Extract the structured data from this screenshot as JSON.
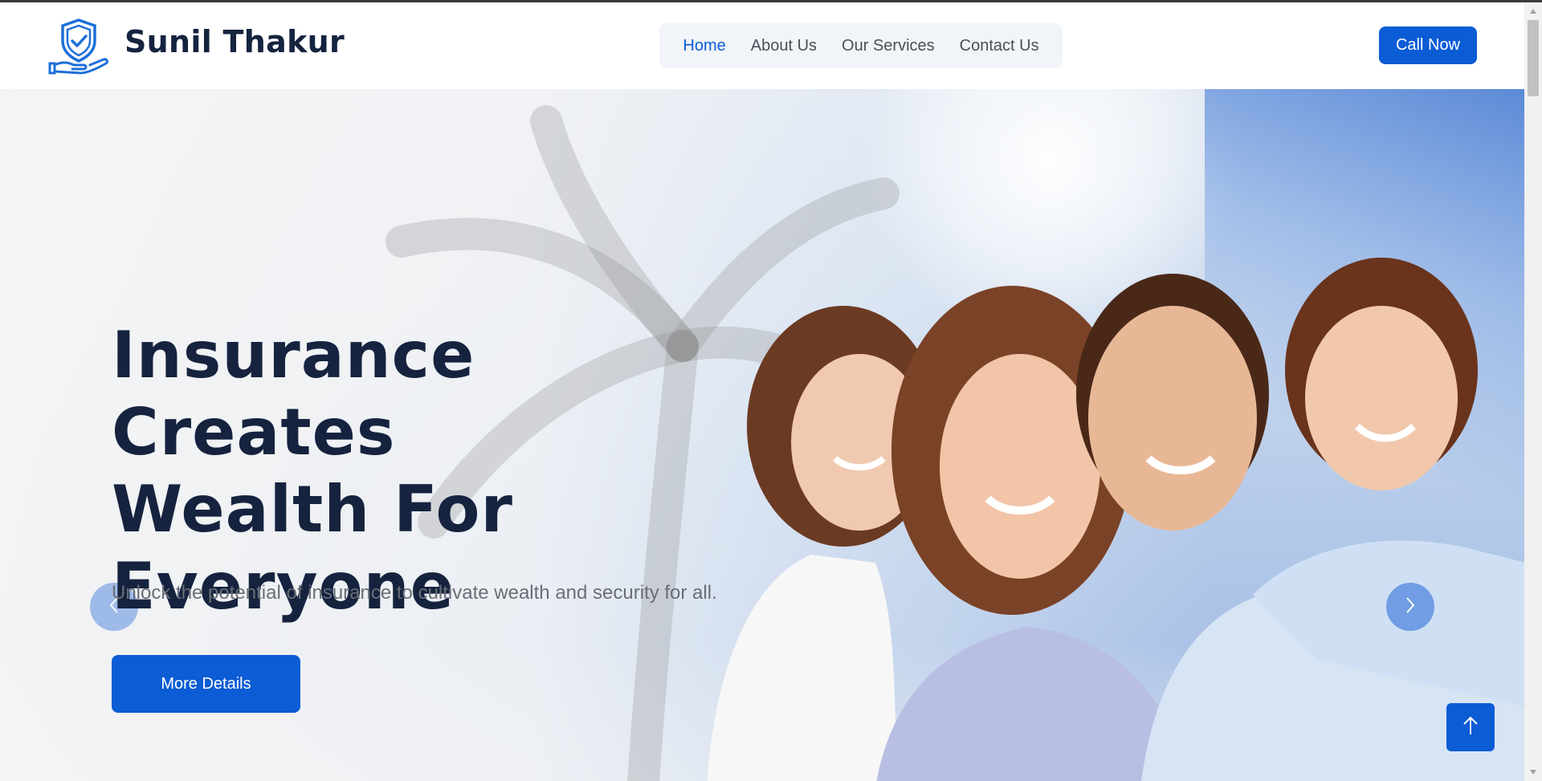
{
  "header": {
    "brand": "Sunil Thakur",
    "logo_icon": "shield-hand-icon",
    "nav": [
      {
        "label": "Home",
        "active": true
      },
      {
        "label": "About Us",
        "active": false
      },
      {
        "label": "Our Services",
        "active": false
      },
      {
        "label": "Contact Us",
        "active": false
      }
    ],
    "call_label": "Call Now"
  },
  "hero": {
    "headline_line1": "Insurance Creates",
    "headline_line2": "Wealth For",
    "headline_line3": "Everyone",
    "subtitle": "Unlock the potential of insurance to cultivate wealth and security for all.",
    "cta_label": "More Details",
    "prev_icon": "chevron-left-icon",
    "next_icon": "chevron-right-icon",
    "image": "family-photo"
  },
  "back_to_top_icon": "arrow-up-icon",
  "colors": {
    "primary": "#0b5cd5",
    "heading": "#15233f",
    "nav_text": "#4a4f57",
    "subtitle": "#6a6e75"
  }
}
